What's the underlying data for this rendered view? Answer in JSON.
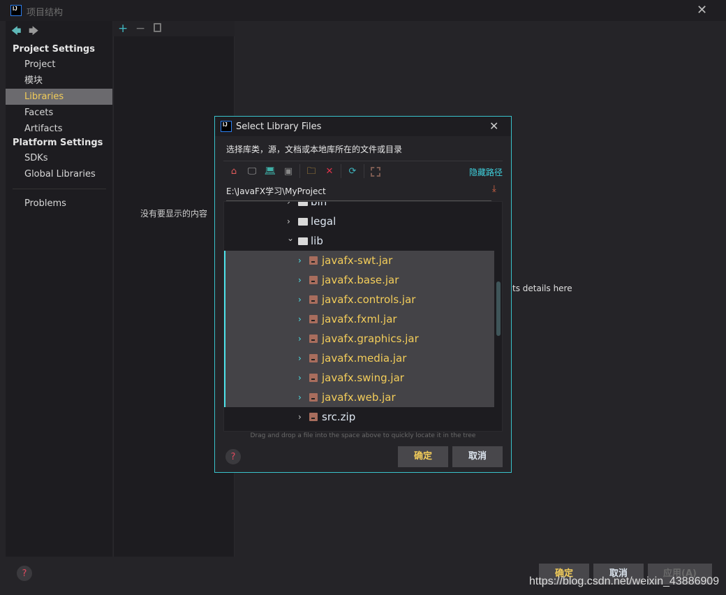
{
  "window": {
    "title": "项目结构",
    "logo": "IJ"
  },
  "sidebar": {
    "sections": [
      {
        "label": "Project Settings",
        "items": [
          {
            "label": "Project"
          },
          {
            "label": "模块"
          },
          {
            "label": "Libraries",
            "selected": true
          },
          {
            "label": "Facets"
          },
          {
            "label": "Artifacts"
          }
        ]
      },
      {
        "label": "Platform Settings",
        "items": [
          {
            "label": "SDKs"
          },
          {
            "label": "Global Libraries"
          }
        ]
      }
    ],
    "problems": "Problems"
  },
  "middle": {
    "empty_text": "没有要显示的内容"
  },
  "right": {
    "details_text": "ts details here"
  },
  "bottom": {
    "ok": "确定",
    "cancel": "取消",
    "apply": "应用(A)"
  },
  "watermark": "https://blog.csdn.net/weixin_43886909",
  "dialog": {
    "title": "Select Library Files",
    "description": "选择库类，源，文档或本地库所在的文件或目录",
    "hide_path": "隐藏路径",
    "path": "E:\\JavaFX学习\\MyProject",
    "tree": [
      {
        "label": "bin",
        "type": "folder",
        "expanded": false,
        "level": 0
      },
      {
        "label": "legal",
        "type": "folder",
        "expanded": false,
        "level": 0
      },
      {
        "label": "lib",
        "type": "folder",
        "expanded": true,
        "level": 0
      },
      {
        "label": "javafx-swt.jar",
        "type": "jar",
        "level": 1,
        "selected": true
      },
      {
        "label": "javafx.base.jar",
        "type": "jar",
        "level": 1,
        "selected": true
      },
      {
        "label": "javafx.controls.jar",
        "type": "jar",
        "level": 1,
        "selected": true
      },
      {
        "label": "javafx.fxml.jar",
        "type": "jar",
        "level": 1,
        "selected": true
      },
      {
        "label": "javafx.graphics.jar",
        "type": "jar",
        "level": 1,
        "selected": true
      },
      {
        "label": "javafx.media.jar",
        "type": "jar",
        "level": 1,
        "selected": true
      },
      {
        "label": "javafx.swing.jar",
        "type": "jar",
        "level": 1,
        "selected": true
      },
      {
        "label": "javafx.web.jar",
        "type": "jar",
        "level": 1,
        "selected": true
      },
      {
        "label": "src.zip",
        "type": "jar",
        "level": 1,
        "selected": false
      }
    ],
    "drag_hint": "Drag and drop a file into the space above to quickly locate it in the tree",
    "ok": "确定",
    "cancel": "取消"
  },
  "colors": {
    "accent": "#39c3cc",
    "selected_text": "#f3cd5a",
    "selection_bg": "#444347"
  }
}
